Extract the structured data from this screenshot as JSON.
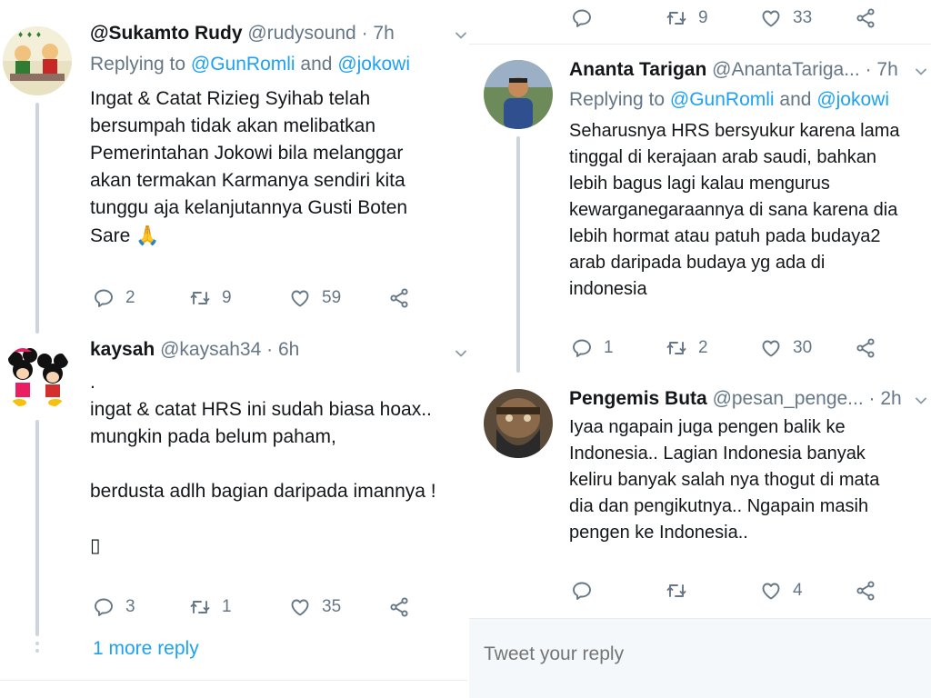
{
  "left": {
    "tweets": [
      {
        "name": "@Sukamto Rudy",
        "handle": "@rudysound",
        "dot": "·",
        "time": "7h",
        "replying_prefix": "Replying to ",
        "mention1": "@GunRomli",
        "and": " and ",
        "mention2": "@jokowi",
        "text": "Ingat & Catat Rizieg Syihab telah\nbersumpah tidak akan melibatkan\nPemerintahan Jokowi bila melanggar\nakan termakan Karmanya sendiri kita\ntunggu aja kelanjutannya Gusti Boten\nSare",
        "emoji": "🙏",
        "reply_count": "2",
        "retweet_count": "9",
        "like_count": "59"
      },
      {
        "name": "kaysah",
        "handle": "@kaysah34",
        "dot": "·",
        "time": "6h",
        "text": ".\ningat & catat HRS ini sudah biasa hoax..\nmungkin pada belum paham,\n\nberdusta adlh bagian daripada imannya !\n\n▯",
        "reply_count": "3",
        "retweet_count": "1",
        "like_count": "35"
      }
    ],
    "more_reply": "1 more reply"
  },
  "right": {
    "top_actions": {
      "reply_count": "",
      "retweet_count": "9",
      "like_count": "33"
    },
    "tweets": [
      {
        "name": "Ananta Tarigan",
        "handle": "@AnantaTariga...",
        "dot": "·",
        "time": "7h",
        "replying_prefix": "Replying to ",
        "mention1": "@GunRomli",
        "and": " and ",
        "mention2": "@jokowi",
        "text": "Seharusnya HRS bersyukur karena lama\ntinggal di kerajaan arab saudi, bahkan\nlebih bagus lagi kalau mengurus\nkewarganegaraannya di sana karena dia\nlebih hormat atau patuh pada budaya2\narab daripada budaya yg ada di\nindonesia",
        "reply_count": "1",
        "retweet_count": "2",
        "like_count": "30"
      },
      {
        "name": "Pengemis Buta",
        "handle": "@pesan_penge...",
        "dot": "·",
        "time": "2h",
        "text": "Iyaa ngapain juga pengen balik ke\nIndonesia.. Lagian Indonesia banyak\nkeliru banyak salah nya thogut di mata\ndia dan pengikutnya.. Ngapain masih\npengen ke Indonesia..",
        "reply_count": "",
        "retweet_count": "",
        "like_count": "4"
      }
    ],
    "compose_placeholder": "Tweet your reply"
  },
  "colors": {
    "accent": "#1da1f2",
    "muted": "#657786",
    "text": "#14171a",
    "divider": "#e6ecf0"
  },
  "icons": [
    "reply-icon",
    "retweet-icon",
    "like-icon",
    "share-icon",
    "chevron-down-icon"
  ]
}
